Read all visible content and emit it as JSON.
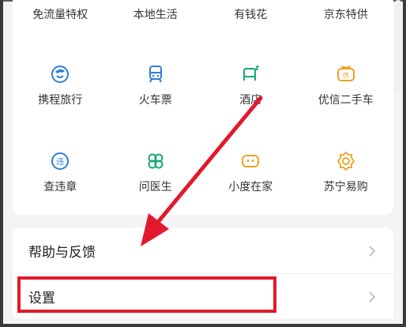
{
  "top_row": [
    "免流量特权",
    "本地生活",
    "有钱花",
    "京东特供"
  ],
  "services_row1": [
    {
      "label": "携程旅行",
      "icon": "ctrip-icon"
    },
    {
      "label": "火车票",
      "icon": "train-icon"
    },
    {
      "label": "酒店",
      "icon": "hotel-bed-icon"
    },
    {
      "label": "优信二手车",
      "icon": "used-car-icon"
    }
  ],
  "services_row2": [
    {
      "label": "查违章",
      "icon": "traffic-violation-icon"
    },
    {
      "label": "问医生",
      "icon": "clover-doctor-icon"
    },
    {
      "label": "小度在家",
      "icon": "xiaodu-icon"
    },
    {
      "label": "苏宁易购",
      "icon": "suning-icon"
    }
  ],
  "list": {
    "help_label": "帮助与反馈",
    "settings_label": "设置"
  },
  "colors": {
    "blue": "#2f7fd6",
    "green": "#1aa776",
    "orange": "#f0a020",
    "annotation_red": "#e2192c"
  }
}
